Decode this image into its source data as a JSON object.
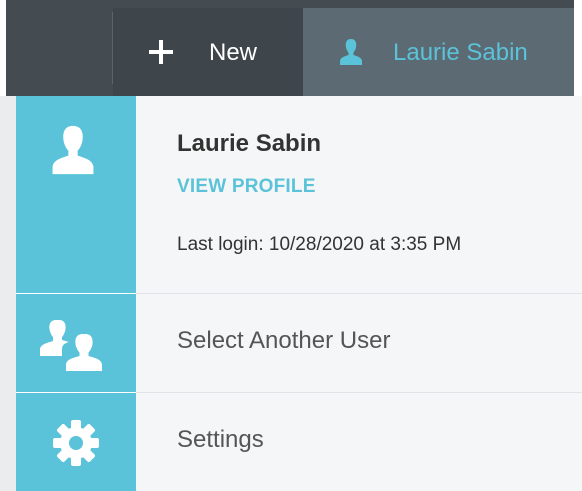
{
  "topbar": {
    "new_label": "New",
    "new_icon": "plus-icon",
    "user_name": "Laurie Sabin",
    "user_icon": "user-icon"
  },
  "profile": {
    "name": "Laurie Sabin",
    "view_profile_label": "VIEW PROFILE",
    "last_login": "Last login: 10/28/2020 at 3:35 PM",
    "icon": "user-icon"
  },
  "menu": {
    "items": [
      {
        "label": "Select Another User",
        "icon": "users-icon"
      },
      {
        "label": "Settings",
        "icon": "gear-icon"
      }
    ]
  },
  "colors": {
    "accent": "#5bc3d9",
    "topbar": "#454c51",
    "panel": "#f5f6f7"
  }
}
